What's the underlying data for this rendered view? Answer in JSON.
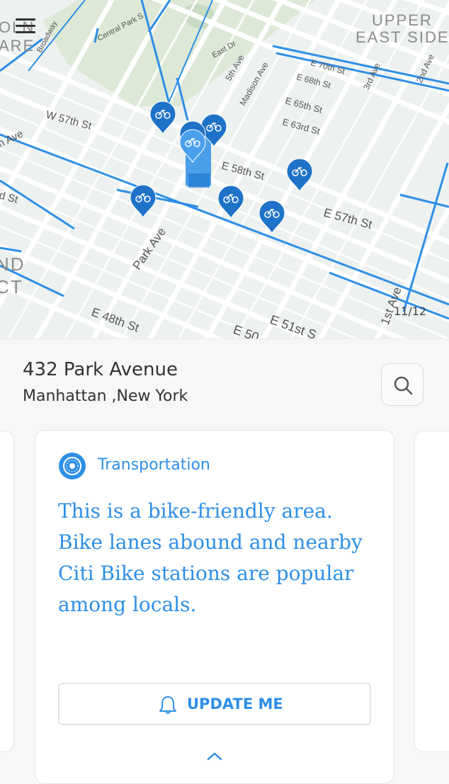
{
  "map": {
    "neighborhood_labels": [
      "UPPER",
      "EAST SIDE",
      "OLN",
      "ARE",
      "ND",
      "CT"
    ],
    "street_labels": [
      "Broadway",
      "Central Park S",
      "East Dr",
      "5th Ave",
      "Madison Ave",
      "E 70th St",
      "E 68th St",
      "E 65th St",
      "E 63rd St",
      "3rd Ave",
      "2nd Ave",
      "W 57th St",
      "n Ave",
      "d St",
      "E 58th St",
      "E 57th St",
      "Park Ave",
      "E 48th St",
      "E 51st S",
      "E 50",
      "1st Ave"
    ],
    "markers": [
      "citi-bike-station",
      "citi-bike-station",
      "citi-bike-station",
      "citi-bike-station",
      "citi-bike-station",
      "citi-bike-station",
      "citi-bike-station",
      "citi-bike-station"
    ],
    "page_counter": "11/12",
    "colors": {
      "lane": "#2e8fe6",
      "park": "#dde9d6",
      "street": "#ffffff",
      "ground": "#edf1ef"
    }
  },
  "location": {
    "title": "432 Park Avenue",
    "subtitle": "Manhattan ,New York",
    "search_icon": "search-icon"
  },
  "card": {
    "category_icon": "transport-wheel-icon",
    "category": "Transportation",
    "text": "This is a bike-friendly area. Bike lanes abound and nearby Citi Bike stations are popular among locals.",
    "button_icon": "bell-icon",
    "button_label": "UPDATE ME",
    "expand_icon": "chevron-up-icon"
  },
  "colors": {
    "accent": "#2e8fe6",
    "text": "#333333",
    "background": "#f7f7f7"
  }
}
